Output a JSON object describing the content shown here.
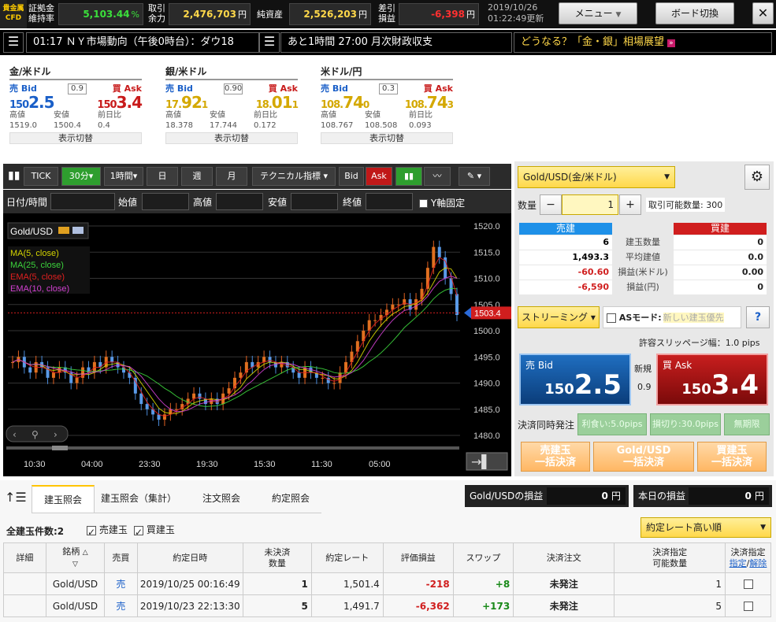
{
  "topbar": {
    "logo_line1": "貴金属",
    "logo_line2": "CFD",
    "margin_label1": "証拠金",
    "margin_label2": "維持率",
    "margin_value": "5,103.44",
    "margin_unit": "%",
    "avail_label1": "取引",
    "avail_label2": "余力",
    "avail_value": "2,476,703",
    "avail_unit": "円",
    "net_label": "純資産",
    "net_value": "2,526,203",
    "net_unit": "円",
    "diff_label1": "差引",
    "diff_label2": "損益",
    "diff_value": "-6,398",
    "diff_unit": "円",
    "date": "2019/10/26",
    "updated": "01:22:49更新",
    "menu_button": "メニュー",
    "board_button": "ボード切換",
    "close_button": "✕"
  },
  "ticker": {
    "news1": "01:17 ＮＹ市場動向（午後0時台）：ダウ18",
    "news2": "あと1時間 27:00 月次財政収支",
    "promo": "どうなる？「金・銀」相場展望"
  },
  "prices": [
    {
      "name": "金/米ドル",
      "bid_label": "売 Bid",
      "ask_label": "買 Ask",
      "spread": "0.9",
      "bid_small": "150",
      "bid_big": "2.5",
      "ask_small": "150",
      "ask_big": "3.4",
      "bid_color": "#1a5fc8",
      "ask_color": "#c81a1a",
      "high_label": "高値",
      "low_label": "安値",
      "chg_label": "前日比",
      "high": "1519.0",
      "low": "1500.4",
      "chg": "0.4",
      "toggle": "表示切替"
    },
    {
      "name": "銀/米ドル",
      "bid_label": "売 Bid",
      "ask_label": "買 Ask",
      "spread": "0.90",
      "bid_small": "17.",
      "bid_big": "92",
      "bid_tail": "1",
      "ask_small": "18.",
      "ask_big": "01",
      "ask_tail": "1",
      "bid_color": "#d4a800",
      "ask_color": "#d4a800",
      "high_label": "高値",
      "low_label": "安値",
      "chg_label": "前日比",
      "high": "18.378",
      "low": "17.744",
      "chg": "0.172",
      "toggle": "表示切替"
    },
    {
      "name": "米ドル/円",
      "bid_label": "売 Bid",
      "ask_label": "買 Ask",
      "spread": "0.3",
      "bid_small": "108.",
      "bid_big": "74",
      "bid_tail": "0",
      "ask_small": "108.",
      "ask_big": "74",
      "ask_tail": "3",
      "bid_color": "#d4a800",
      "ask_color": "#d4a800",
      "high_label": "高値",
      "low_label": "安値",
      "chg_label": "前日比",
      "high": "108.767",
      "low": "108.508",
      "chg": "0.093",
      "toggle": "表示切替"
    }
  ],
  "chart_toolbar": {
    "tick": "TICK",
    "m30": "30分",
    "h1": "1時間",
    "day": "日",
    "week": "週",
    "month": "月",
    "tech": "テクニカル指標",
    "bid": "Bid",
    "ask": "Ask"
  },
  "chart_filter": {
    "datetime": "日付/時間",
    "open": "始値",
    "high": "高値",
    "low": "安値",
    "close": "終値",
    "yfix": "Y軸固定"
  },
  "chart_data": {
    "type": "line",
    "title": "Gold/USD",
    "legend": [
      "MA(5, close)",
      "MA(25, close)",
      "EMA(5, close)",
      "EMA(10, close)"
    ],
    "legend_colors": [
      "#d4d400",
      "#3cd33c",
      "#e02020",
      "#d040d0"
    ],
    "y_ticks": [
      "1520.0",
      "1515.0",
      "1510.0",
      "1505.0",
      "1500.0",
      "1495.0",
      "1490.0",
      "1485.0",
      "1480.0"
    ],
    "ylim": [
      1480,
      1520
    ],
    "x_ticks": [
      "10:30",
      "04:00",
      "23:30",
      "19:30",
      "15:30",
      "11:30",
      "05:00"
    ],
    "current_price": "1503.4",
    "series_close": [
      1494,
      1495,
      1493,
      1492,
      1494,
      1493,
      1491,
      1492,
      1493,
      1492,
      1490,
      1491,
      1493,
      1492,
      1494,
      1493,
      1495,
      1494,
      1493,
      1492,
      1491,
      1488,
      1486,
      1485,
      1484,
      1483,
      1484,
      1485,
      1485,
      1486,
      1487,
      1488,
      1487,
      1486,
      1487,
      1486,
      1488,
      1489,
      1491,
      1492,
      1494,
      1493,
      1494,
      1495,
      1494,
      1493,
      1494,
      1493,
      1492,
      1491,
      1493,
      1492,
      1491,
      1491,
      1490,
      1490,
      1492,
      1494,
      1496,
      1498,
      1500,
      1502,
      1502,
      1503,
      1504,
      1505,
      1505,
      1506,
      1504,
      1506,
      1508,
      1512,
      1516,
      1514,
      1510,
      1507,
      1503
    ]
  },
  "order": {
    "symbol": "Gold/USD(金/米ドル)",
    "qty_label": "数量",
    "qty": "1",
    "minus": "−",
    "plus": "+",
    "tradable": "取引可能数量: 300",
    "sell_header": "売建",
    "buy_header": "買建",
    "rows": [
      {
        "sell": "6",
        "label": "建玉数量",
        "buy": "0"
      },
      {
        "sell": "1,493.3",
        "label": "平均建値",
        "buy": "0.0"
      },
      {
        "sell": "-60.60",
        "label": "損益(米ドル)",
        "buy": "0.00"
      },
      {
        "sell": "-6,590",
        "label": "損益(円)",
        "buy": "0"
      }
    ],
    "streaming": "ストリーミング",
    "as_mode": "ASモード:",
    "as_placeholder": "新しい建玉優先",
    "help": "?",
    "slippage": "許容スリッページ幅：1.0 pips",
    "bid_label": "売 Bid",
    "ask_label": "買 Ask",
    "bid_small": "150",
    "bid_big": "2.5",
    "ask_small": "150",
    "ask_big": "3.4",
    "new_label": "新規",
    "spread": "0.9",
    "settle_label": "決済同時発注",
    "profit": "利食い:5.0pips",
    "loss": "損切り:30.0pips",
    "unlimited": "無期限",
    "bulk_sell1": "売建玉",
    "bulk_sell2": "一括決済",
    "bulk_sym1": "Gold/USD",
    "bulk_sym2": "一括決済",
    "bulk_buy1": "買建玉",
    "bulk_buy2": "一括決済"
  },
  "bottom": {
    "tabs": [
      "建玉照会",
      "建玉照会（集計）",
      "注文照会",
      "約定照会"
    ],
    "pl_label": "Gold/USDの損益",
    "pl_value": "0",
    "pl_unit": "円",
    "today_label": "本日の損益",
    "today_value": "0",
    "today_unit": "円",
    "count": "全建玉件数:2",
    "sell_filter": "売建玉",
    "buy_filter": "買建玉",
    "sort": "約定レート高い順",
    "headers": [
      "詳細",
      "銘柄",
      "売買",
      "約定日時",
      "未決済\n数量",
      "約定レート",
      "評価損益",
      "スワップ",
      "決済注文",
      "決済指定\n可能数量",
      "決済指定"
    ],
    "h_designate": "指定",
    "h_cancel": "解除",
    "rows": [
      {
        "symbol": "Gold/USD",
        "side": "売",
        "date": "2019/10/25 00:16:49",
        "qty": "1",
        "rate": "1,501.4",
        "pl": "-218",
        "swap": "+8",
        "order": "未発注",
        "avail": "1"
      },
      {
        "symbol": "Gold/USD",
        "side": "売",
        "date": "2019/10/23 22:13:30",
        "qty": "5",
        "rate": "1,491.7",
        "pl": "-6,362",
        "swap": "+173",
        "order": "未発注",
        "avail": "5"
      }
    ]
  }
}
